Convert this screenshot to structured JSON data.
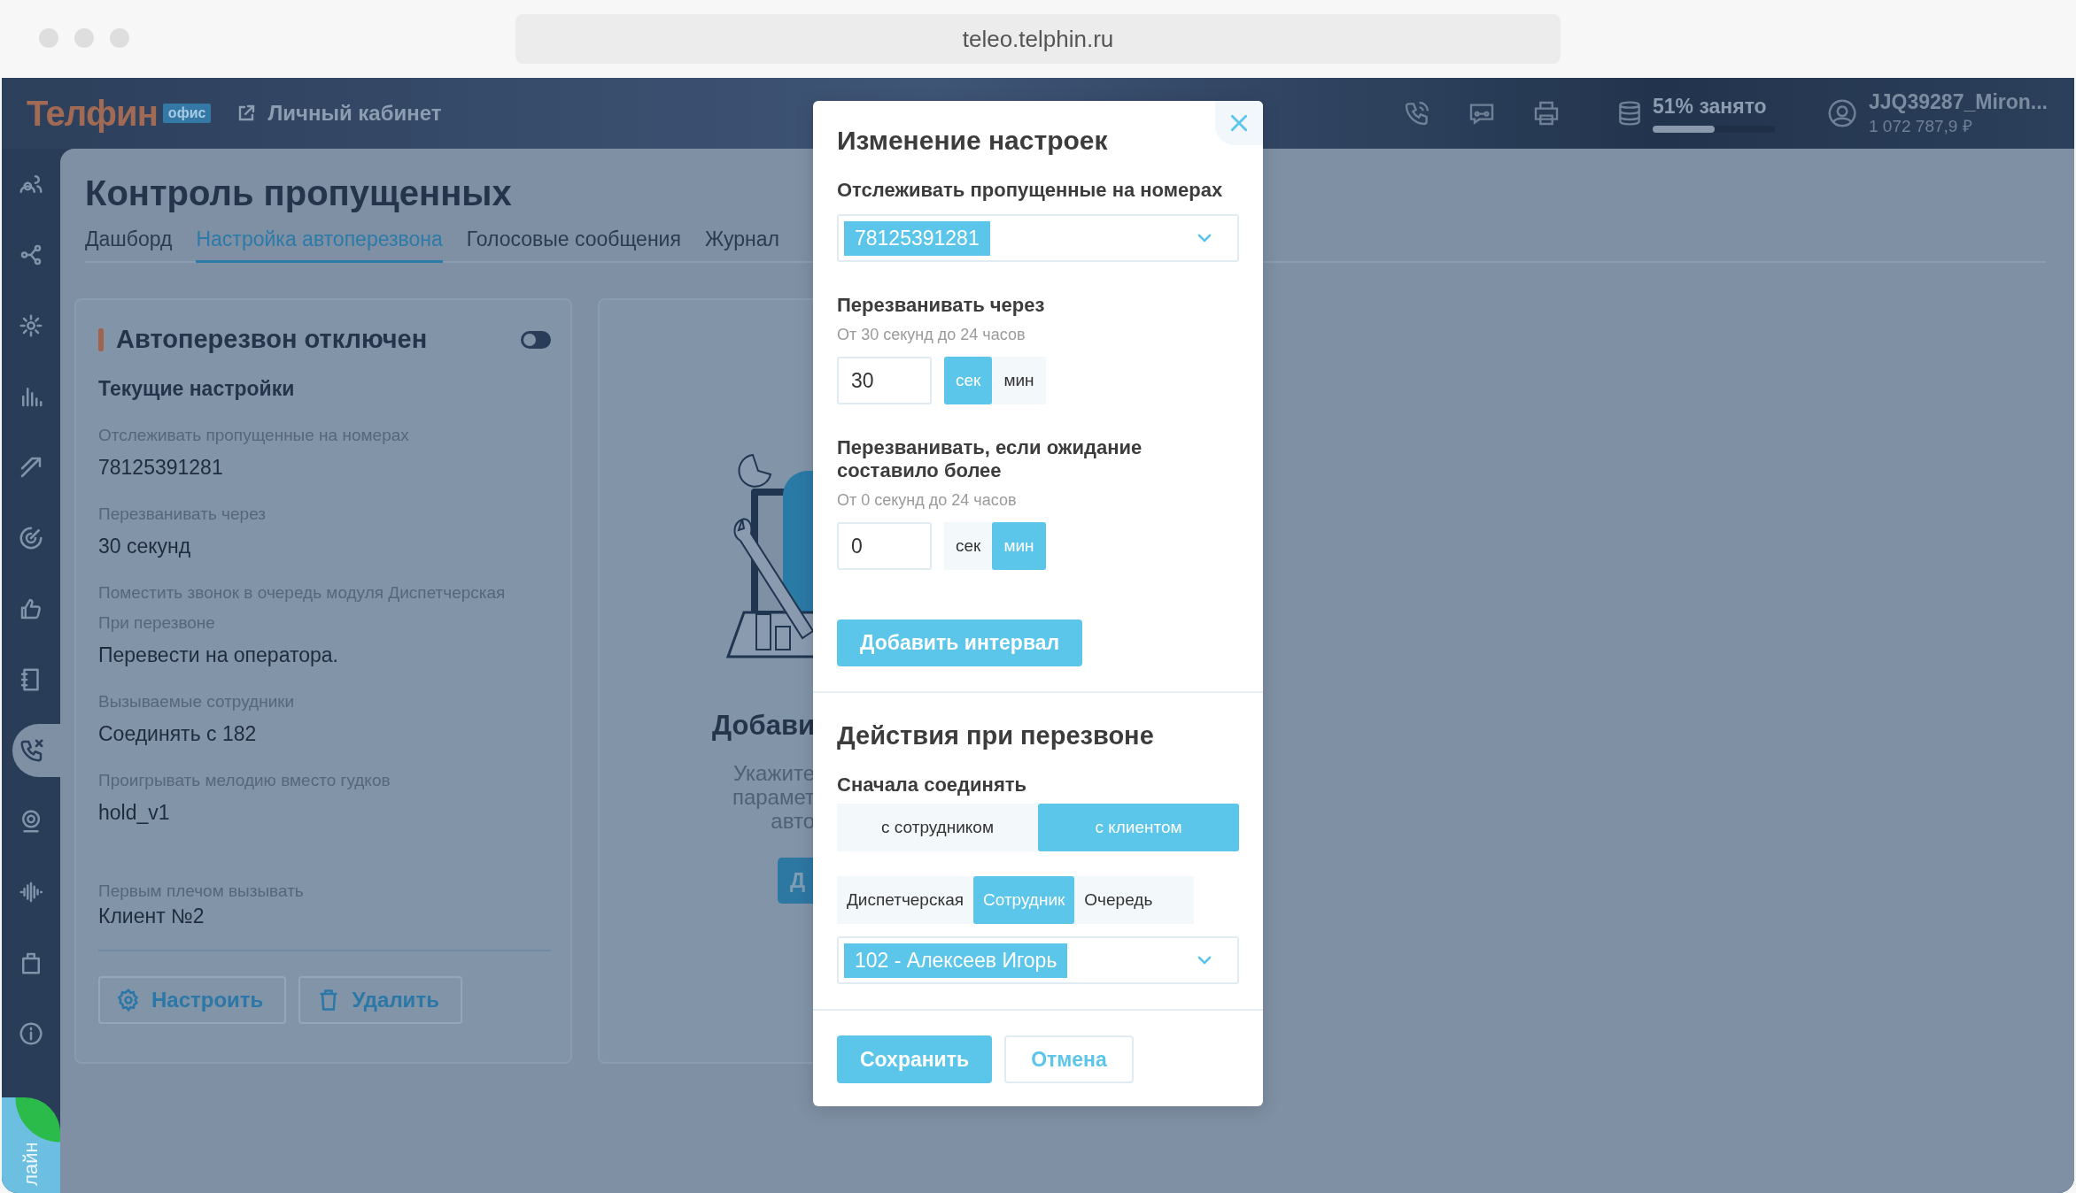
{
  "browser": {
    "url": "teleo.telphin.ru"
  },
  "header": {
    "logo": "Телфин",
    "logo_badge": "офис",
    "cabinet_link": "Личный кабинет",
    "storage": {
      "label": "51% занято",
      "level": 0.51
    },
    "account": {
      "name": "JJQ39287_Miron...",
      "balance": "1 072 787,9 ₽"
    }
  },
  "sidebar": {
    "items": [
      {
        "selected": false
      },
      {
        "selected": false
      },
      {
        "selected": false
      },
      {
        "selected": false
      },
      {
        "selected": false
      },
      {
        "selected": false
      },
      {
        "selected": false
      },
      {
        "selected": false
      },
      {
        "selected": true
      },
      {
        "selected": false
      },
      {
        "selected": false
      },
      {
        "selected": false
      },
      {
        "selected": false
      }
    ],
    "status_badge": "лайн"
  },
  "page": {
    "title": "Контроль пропущенных",
    "tabs": [
      {
        "label": "Дашборд",
        "selected": false
      },
      {
        "label": "Настройка автоперезвона",
        "selected": true
      },
      {
        "label": "Голосовые сообщения",
        "selected": false
      },
      {
        "label": "Журнал",
        "selected": false
      }
    ]
  },
  "status_card": {
    "title": "Автоперезвон отключен",
    "enabled": false,
    "section_title": "Текущие настройки",
    "fields": [
      {
        "label": "Отслеживать пропущенные на номерах",
        "value": "78125391281"
      },
      {
        "label": "Перезванивать через",
        "value": "30 секунд"
      },
      {
        "label": "Поместить звонок в очередь модуля Диспетчерская"
      },
      {
        "label": "При перезвоне",
        "value": "Перевести на оператора."
      },
      {
        "label": "Вызываемые сотрудники",
        "value": "Соединять с 182"
      },
      {
        "label": "Проигрывать мелодию вместо гудков",
        "value": "hold_v1"
      },
      {
        "label": "Первым плечом вызывать",
        "value": "Клиент №2"
      }
    ],
    "buttons": [
      {
        "label": "Настроить",
        "kind": "settings"
      },
      {
        "label": "Удалить",
        "kind": "delete"
      }
    ]
  },
  "add_card": {
    "title": "Добави",
    "text_lines": [
      "Укажите",
      "парамет",
      "авто"
    ],
    "button": "Д"
  },
  "modal": {
    "title": "Изменение настроек",
    "numbers_field": {
      "label": "Отслеживать пропущенные на номерах",
      "tags": [
        "78125391281"
      ]
    },
    "intervals": [
      {
        "label": "Перезванивать через",
        "hint": "От 30 секунд до 24 часов",
        "value": "30",
        "units": [
          {
            "label": "сек",
            "selected": true
          },
          {
            "label": "мин",
            "selected": false
          }
        ]
      },
      {
        "label": "Перезванивать, если ожидание составило более",
        "hint": "От 0 секунд до 24 часов",
        "value": "0",
        "units": [
          {
            "label": "сек",
            "selected": false
          },
          {
            "label": "мин",
            "selected": true
          }
        ]
      }
    ],
    "add_interval_button": "Добавить интервал",
    "actions": {
      "title": "Действия при перезвоне",
      "connect_label": "Сначала соединять",
      "connect_options": [
        {
          "label": "с сотрудником",
          "selected": false
        },
        {
          "label": "с клиентом",
          "selected": true
        }
      ],
      "target_options": [
        {
          "label": "Диспетчерская",
          "selected": false
        },
        {
          "label": "Сотрудник",
          "selected": true
        },
        {
          "label": "Очередь",
          "selected": false
        }
      ],
      "target_field": {
        "tags": [
          "102 - Алексеев Игорь"
        ]
      }
    },
    "buttons": [
      {
        "label": "Сохранить",
        "kind": "primary"
      },
      {
        "label": "Отмена",
        "kind": "secondary"
      }
    ]
  }
}
